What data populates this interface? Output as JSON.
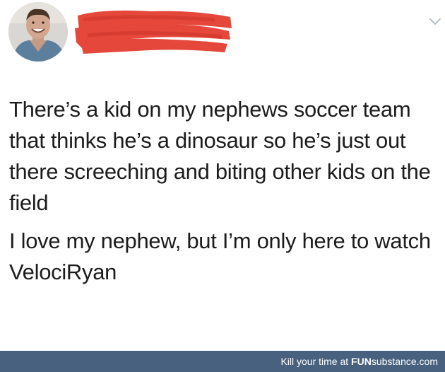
{
  "tweet": {
    "paragraph_1": "There’s a kid on my nephews soccer team that thinks he’s a dinosaur so he’s just out there screeching and biting other kids on the field",
    "paragraph_2": "I love my nephew, but I’m only here to watch VelociRyan"
  },
  "icons": {
    "avatar": "profile-photo",
    "menu": "chevron-down-icon",
    "redaction": "red-scribble"
  },
  "colors": {
    "redaction": "#e5473a",
    "footer_bg": "#48617f",
    "text": "#1c1c1c"
  },
  "footer": {
    "tagline": "Kill your time at ",
    "brand_bold": "FUN",
    "brand_rest": "substance",
    "brand_tld": ".com"
  }
}
